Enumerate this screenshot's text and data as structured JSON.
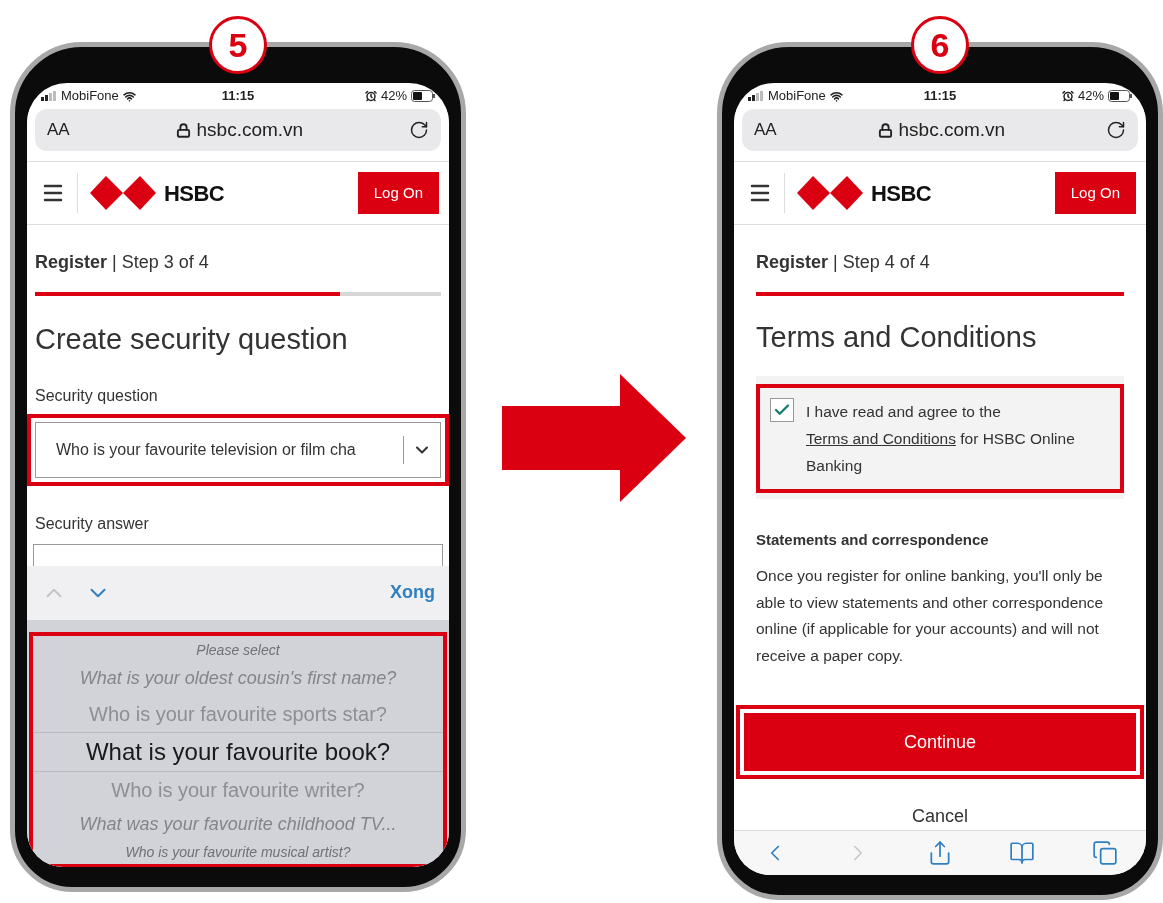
{
  "screens": [
    {
      "kind": "security_question",
      "step_badge": "5",
      "status_bar": {
        "carrier": "MobiFone",
        "time": "11:15",
        "battery": "42%"
      },
      "address_bar": {
        "text_size": "AA",
        "url": "hsbc.com.vn"
      },
      "header": {
        "logo_text": "HSBC",
        "login_button": "Log On"
      },
      "progress": {
        "heading": "**Register** | Step 3 of 4",
        "level": 0.75
      },
      "title": "Create security question",
      "fields": [
        {
          "kind": "select",
          "label": "Security question",
          "value": "Who is your favourite television or film cha",
          "highlighted": true
        },
        {
          "kind": "text",
          "label": "Security answer"
        }
      ],
      "keyboard_toolbar": {
        "buttons": [
          {
            "kind": "up",
            "disabled": true
          },
          {
            "kind": "down",
            "disabled": false
          }
        ],
        "done": "Xong"
      },
      "picker": {
        "highlighted": true,
        "options": [
          {
            "label": "Please select",
            "selected": false
          },
          {
            "label": "What is your oldest cousin's first name?",
            "selected": false
          },
          {
            "label": "Who is your favourite sports star?",
            "selected": false
          },
          {
            "label": "What is your favourite book?",
            "selected": true
          },
          {
            "label": "Who is your favourite writer?",
            "selected": false
          },
          {
            "label": "What was your favourite childhood TV...",
            "selected": false
          },
          {
            "label": "Who is your favourite musical artist?",
            "selected": false
          }
        ]
      }
    },
    {
      "kind": "terms",
      "step_badge": "6",
      "status_bar": {
        "carrier": "MobiFone",
        "time": "11:15",
        "battery": "42%"
      },
      "address_bar": {
        "text_size": "AA",
        "url": "hsbc.com.vn"
      },
      "header": {
        "logo_text": "HSBC",
        "login_button": "Log On"
      },
      "progress": {
        "heading": "**Register** | Step 4 of 4",
        "level": 1
      },
      "title": "Terms and Conditions",
      "consent": {
        "checked": true,
        "highlighted": true,
        "text": "I have read and agree to the",
        "link": "Terms and Conditions",
        "text_after": "for HSBC Online Banking"
      },
      "section": {
        "heading": "Statements and correspondence",
        "body": "Once you register for online banking, you'll only be able to view statements and other correspondence online (if applicable for your accounts) and will not receive a paper copy."
      },
      "buttons": [
        {
          "kind": "primary",
          "label": "Continue",
          "highlighted": true
        },
        {
          "kind": "link",
          "label": "Cancel"
        }
      ],
      "browser_toolbar": [
        {
          "kind": "back",
          "disabled": false
        },
        {
          "kind": "forward",
          "disabled": true
        },
        {
          "kind": "share",
          "disabled": false
        },
        {
          "kind": "bookmarks",
          "disabled": false
        },
        {
          "kind": "tabs",
          "disabled": false
        }
      ]
    }
  ]
}
